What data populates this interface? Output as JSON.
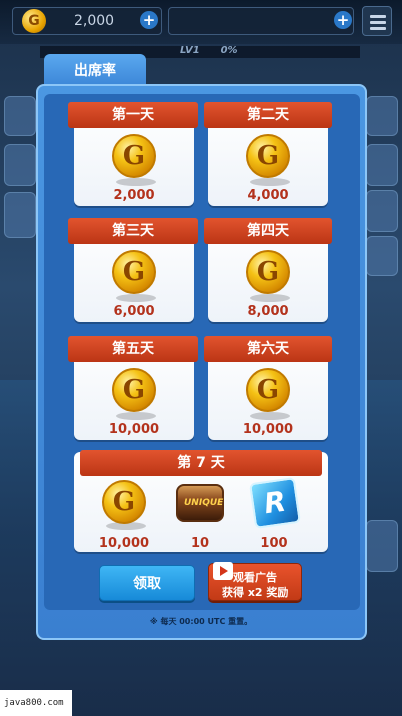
{
  "hud": {
    "coins": "2,000",
    "level_label": "LV1",
    "level_progress": "0%"
  },
  "panel": {
    "tab_title": "出席率",
    "days": [
      {
        "label": "第一天",
        "reward": "2,000"
      },
      {
        "label": "第二天",
        "reward": "4,000"
      },
      {
        "label": "第三天",
        "reward": "6,000"
      },
      {
        "label": "第四天",
        "reward": "8,000"
      },
      {
        "label": "第五天",
        "reward": "10,000"
      },
      {
        "label": "第六天",
        "reward": "10,000"
      }
    ],
    "day7": {
      "label": "第 7 天",
      "rewards": [
        "10,000",
        "10",
        "100"
      ],
      "can_text": "UNIQUE",
      "tile_letter": "R"
    },
    "claim_button": "领取",
    "ad_button": {
      "line1": "观看广告",
      "line2": "获得 x2 奖励"
    },
    "reset_note": "※ 每天 00:00 UTC 重置。"
  },
  "coin_symbol": "G",
  "watermark": "java800.com",
  "colors": {
    "ribbon_red": "#c93d1a",
    "panel_blue": "#3a7fd0",
    "claim_blue": "#178ad8",
    "amount_red": "#b3321c"
  }
}
